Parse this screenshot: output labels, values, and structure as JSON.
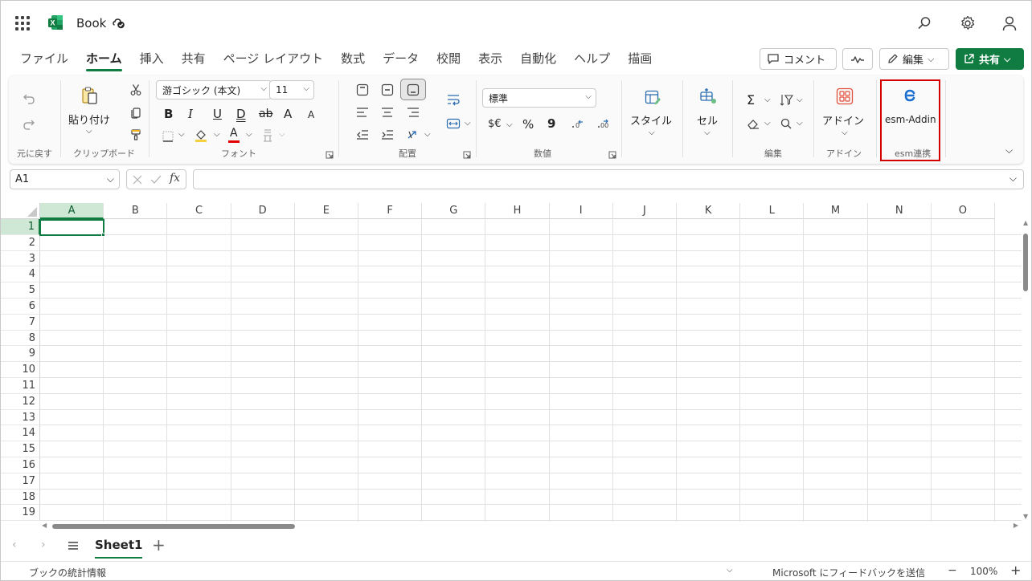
{
  "app": {
    "title": "Book",
    "brand_color": "#107c41"
  },
  "tabs": [
    {
      "label": "ファイル",
      "active": false
    },
    {
      "label": "ホーム",
      "active": true
    },
    {
      "label": "挿入",
      "active": false
    },
    {
      "label": "共有",
      "active": false
    },
    {
      "label": "ページ レイアウト",
      "active": false
    },
    {
      "label": "数式",
      "active": false
    },
    {
      "label": "データ",
      "active": false
    },
    {
      "label": "校閲",
      "active": false
    },
    {
      "label": "表示",
      "active": false
    },
    {
      "label": "自動化",
      "active": false
    },
    {
      "label": "ヘルプ",
      "active": false
    },
    {
      "label": "描画",
      "active": false
    }
  ],
  "topright": {
    "comment_label": "コメント",
    "edit_label": "編集",
    "share_label": "共有"
  },
  "ribbon": {
    "undo_group_label": "元に戻す",
    "paste_label": "貼り付け",
    "clipboard_label": "クリップボード",
    "font_name": "游ゴシック (本文)",
    "font_size": "11",
    "font_label": "フォント",
    "alignment_label": "配置",
    "number_format": "標準",
    "number_label": "数値",
    "styles_label": "スタイル",
    "cells_label": "セル",
    "editing_label": "編集",
    "addins_button": "アドイン",
    "addins_label": "アドイン",
    "esm_button": "esm-Addin",
    "esm_label": "esm連携",
    "bold": "B",
    "italic": "I",
    "underline": "U",
    "double_underline": "D",
    "strike": "ab",
    "grow": "A",
    "shrink": "A",
    "font_color": "A",
    "currency": "$€",
    "percent": "%",
    "comma": "9"
  },
  "formula_bar": {
    "name_box": "A1",
    "fx": "fx",
    "formula": ""
  },
  "grid": {
    "columns": [
      "A",
      "B",
      "C",
      "D",
      "E",
      "F",
      "G",
      "H",
      "I",
      "J",
      "K",
      "L",
      "M",
      "N",
      "O"
    ],
    "rows": [
      "1",
      "2",
      "3",
      "4",
      "5",
      "6",
      "7",
      "8",
      "9",
      "10",
      "11",
      "12",
      "13",
      "14",
      "15",
      "16",
      "17",
      "18",
      "19"
    ],
    "selected_column": "A",
    "selected_row": "1"
  },
  "sheets": [
    {
      "label": "Sheet1",
      "active": true
    }
  ],
  "statusbar": {
    "workbook_stats": "ブックの統計情報",
    "feedback": "Microsoft にフィードバックを送信",
    "zoom_minus": "−",
    "zoom": "100%",
    "zoom_plus": "+"
  }
}
